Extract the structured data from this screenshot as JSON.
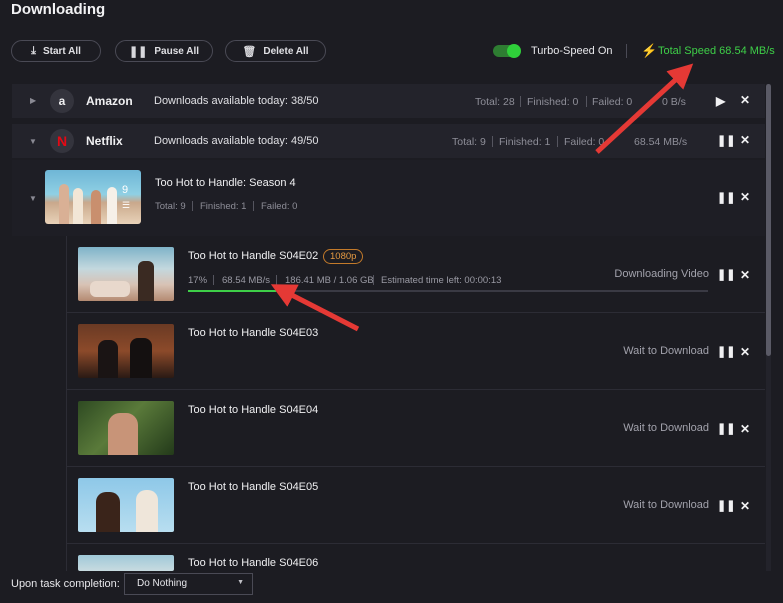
{
  "title": "Downloading",
  "toolbar": {
    "start_all": "Start All",
    "pause_all": "Pause All",
    "delete_all": "Delete All",
    "turbo_label": "Turbo-Speed On",
    "total_speed": "Total Speed 68.54 MB/s"
  },
  "groups": [
    {
      "name": "Amazon",
      "available": "Downloads available today: 38/50",
      "total": "Total: 28",
      "finished": "Finished: 0",
      "failed": "Failed: 0",
      "speed": "0 B/s"
    },
    {
      "name": "Netflix",
      "available": "Downloads available today: 49/50",
      "total": "Total: 9",
      "finished": "Finished: 1",
      "failed": "Failed: 0",
      "speed": "68.54 MB/s"
    }
  ],
  "season": {
    "title": "Too Hot to Handle: Season 4",
    "badge": "9",
    "total": "Total: 9",
    "finished": "Finished: 1",
    "failed": "Failed: 0"
  },
  "episodes": [
    {
      "title": "Too Hot to Handle S04E02",
      "quality": "1080p",
      "percent": "17%",
      "progress": 0.17,
      "speed": "68.54 MB/s",
      "size": "186.41 MB / 1.06 GB",
      "eta": "Estimated time left: 00:00:13",
      "status": "Downloading Video"
    },
    {
      "title": "Too Hot to Handle S04E03",
      "status": "Wait to Download"
    },
    {
      "title": "Too Hot to Handle S04E04",
      "status": "Wait to Download"
    },
    {
      "title": "Too Hot to Handle S04E05",
      "status": "Wait to Download"
    },
    {
      "title": "Too Hot to Handle S04E06"
    }
  ],
  "footer": {
    "label": "Upon task completion:",
    "selected": "Do Nothing"
  },
  "icons": {
    "amazon": "amazon-logo",
    "netflix": "netflix-logo",
    "play": "play-icon",
    "pause": "pause-icon",
    "close": "close-icon"
  },
  "colors": {
    "accent_green": "#3ecf48",
    "badge_orange": "#e59a42",
    "netflix_red": "#e50914",
    "annotation_red": "#e53935"
  }
}
